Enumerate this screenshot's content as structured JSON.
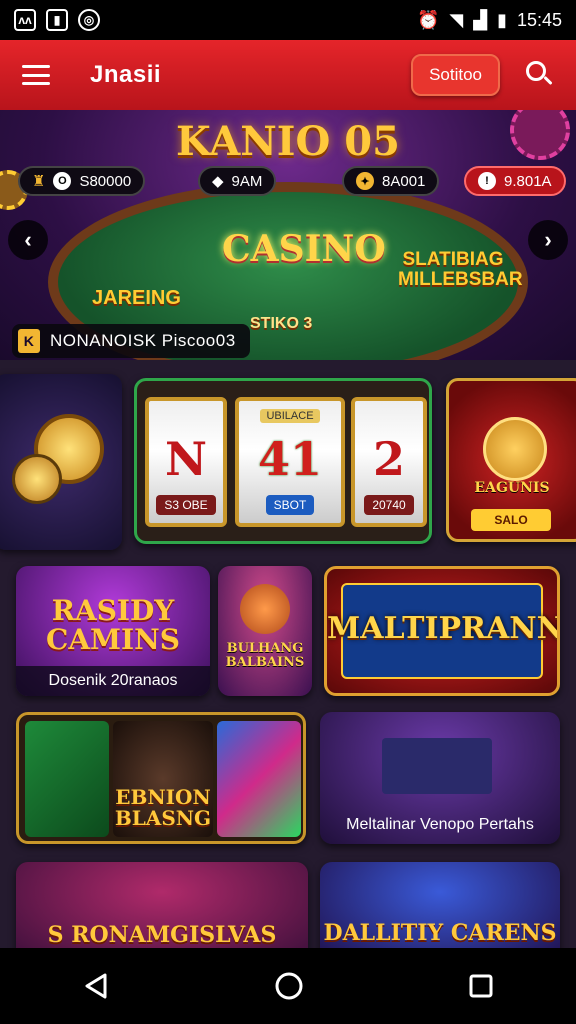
{
  "status_bar": {
    "left_icons": [
      "ʌʌ",
      "▮",
      "◎"
    ],
    "time": "15:45"
  },
  "app_bar": {
    "title": "Jnasii",
    "primary_button": "Sotitoo"
  },
  "hero": {
    "title": "KANIO 05",
    "pills": [
      "S80000",
      "9AM",
      "8A001",
      "9.801A"
    ],
    "center_logo": "CASINO",
    "left_logo": "JAREING",
    "right_logo": "SLATIBIAG MILLEBSBAR",
    "table_label": "STIKO 3",
    "badge_letter": "K",
    "badge_text": "NONANOISK Piscoo03"
  },
  "tiles": {
    "slot_reels": [
      {
        "symbol": "N",
        "label": "S3 OBE"
      },
      {
        "symbol": "41",
        "label": "SBOT"
      },
      {
        "symbol": "2",
        "label": "20740"
      }
    ],
    "slot_top_label": "UBILACE",
    "prize_title": "EAGUNIS",
    "prize_button": "SALO",
    "rasidy_title": "RASIDY CAMINS",
    "rasidy_caption": "Dosenik 20ranaos",
    "bulhang_title": "BULHANG BALBAINS",
    "maltip_title": "MALTIPRANN",
    "ebnion_title": "EBNION BLASNG",
    "meltalin_caption": "Meltalinar Venopo Pertahs",
    "ronamg_title": "S RONAMGISLVAS",
    "dallity_title": "DALLITIY CARENS"
  },
  "nav": {
    "back": "back",
    "home": "home",
    "recents": "recents"
  },
  "colors": {
    "accent": "#d81e26",
    "gold": "#ffc93c",
    "green": "#2fa64a"
  }
}
